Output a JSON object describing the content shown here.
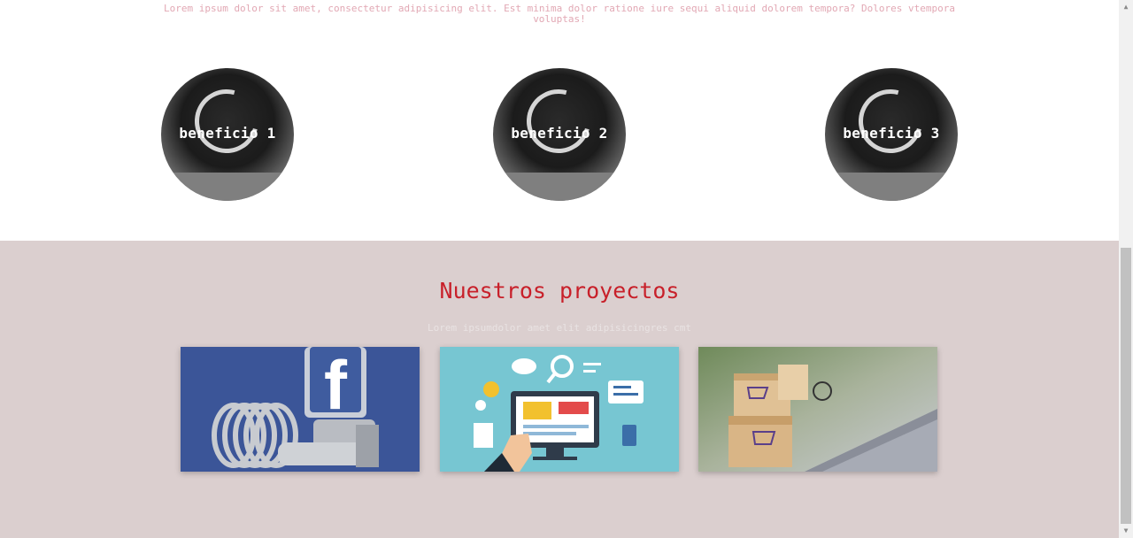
{
  "benefits": {
    "intro": "Lorem ipsum dolor sit amet, consectetur adipisicing elit. Est minima dolor ratione iure sequi aliquid dolorem tempora? Dolores vtempora voluptas!",
    "items": [
      {
        "label": "beneficio 1"
      },
      {
        "label": "beneficio 2"
      },
      {
        "label": "beneficio 3"
      }
    ]
  },
  "projects": {
    "title": "Nuestros proyectos",
    "subtitle": "Lorem ipsumdolor amet elit adipisicingres cmt",
    "cards": [
      {
        "image": "facebook-hardware-image"
      },
      {
        "image": "web-design-illustration"
      },
      {
        "image": "online-shopping-photo"
      }
    ]
  },
  "colors": {
    "title_red": "#c8202a",
    "section_bg": "#dbcfcf",
    "intro_pink": "#e2a8b4"
  }
}
